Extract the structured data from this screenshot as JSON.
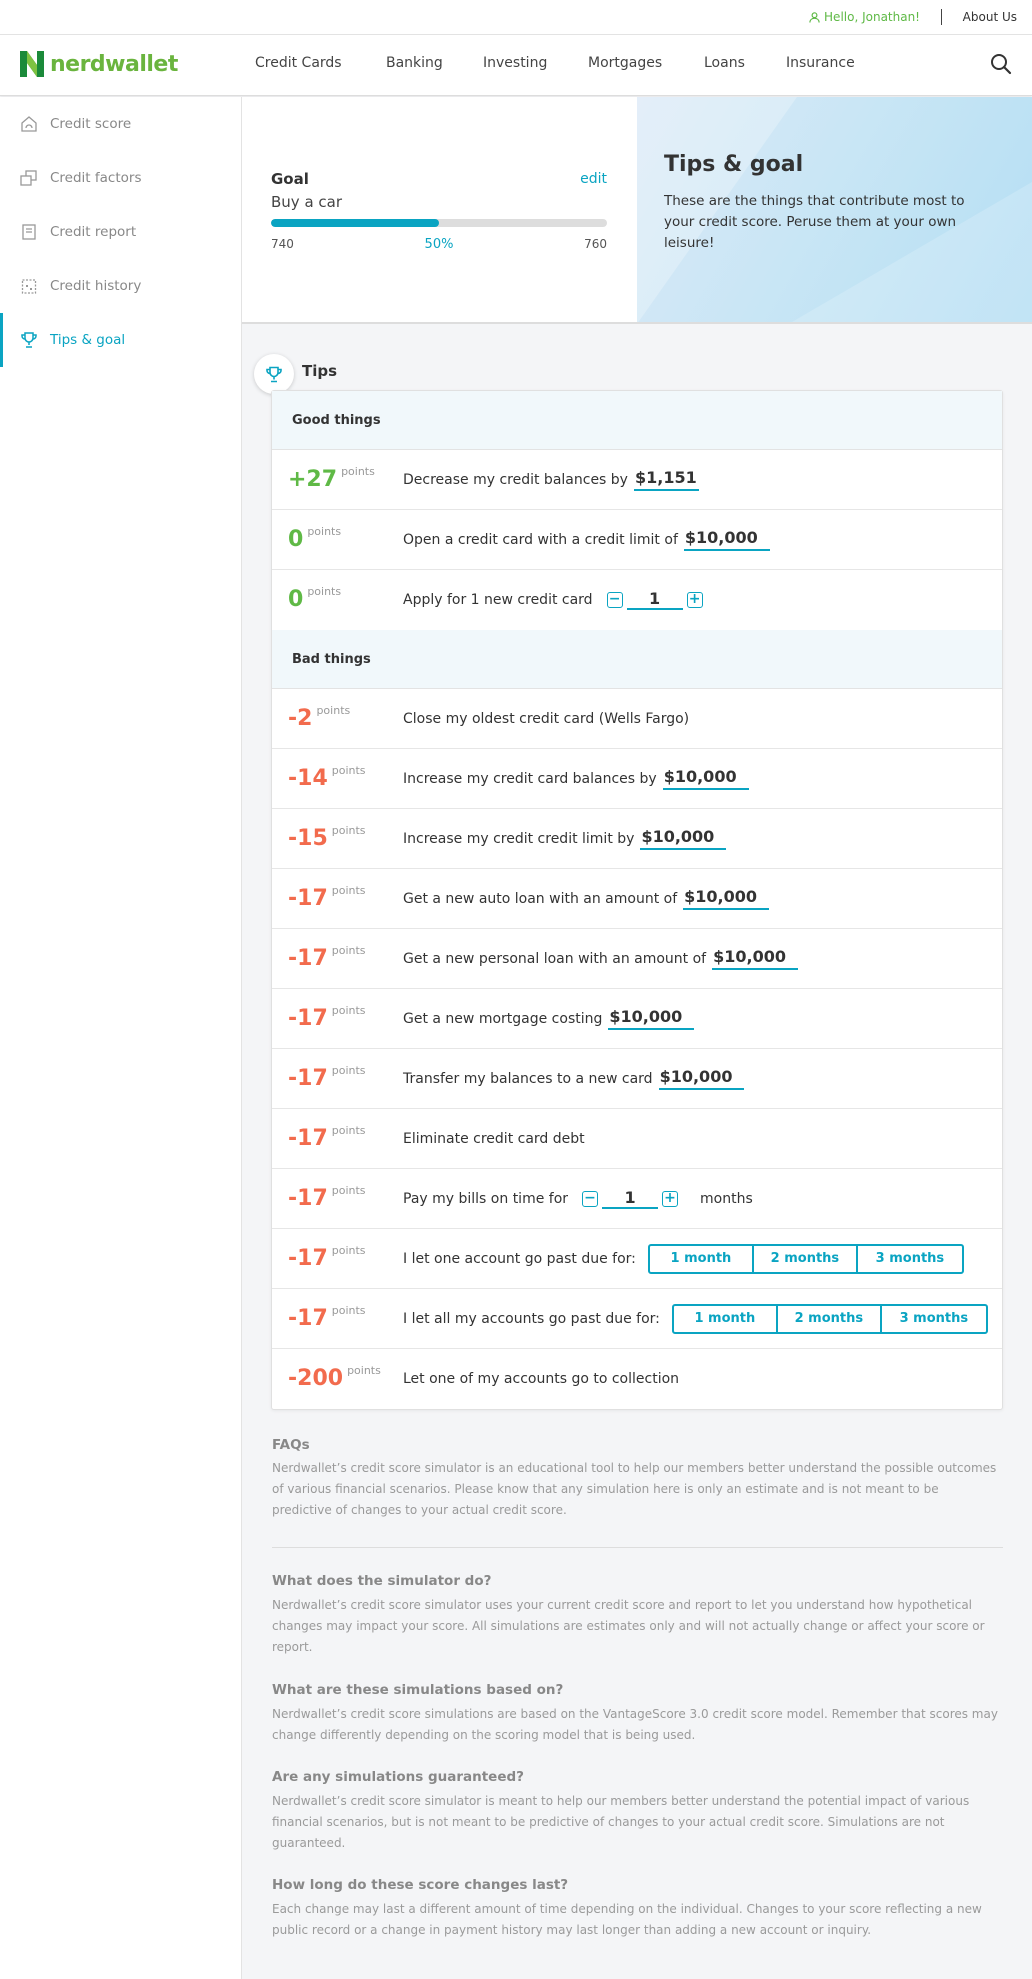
{
  "topbar": {
    "greeting": "Hello, Jonathan!",
    "about": "About Us"
  },
  "brand": {
    "name": "nerdwallet",
    "green": "#6ab43e",
    "accent": "#0aa4c2",
    "negative": "#f26b4d"
  },
  "nav": {
    "items": [
      "Credit Cards",
      "Banking",
      "Investing",
      "Mortgages",
      "Loans",
      "Insurance"
    ]
  },
  "sidebar": {
    "items": [
      {
        "label": "Credit score",
        "icon": "house-gauge-icon"
      },
      {
        "label": "Credit factors",
        "icon": "squares-icon"
      },
      {
        "label": "Credit report",
        "icon": "book-icon"
      },
      {
        "label": "Credit history",
        "icon": "calendar-icon"
      },
      {
        "label": "Tips & goal",
        "icon": "trophy-icon",
        "active": true
      }
    ]
  },
  "goal": {
    "label": "Goal",
    "edit": "edit",
    "name": "Buy a car",
    "min": "740",
    "max": "760",
    "percent_label": "50%",
    "progress": 0.5
  },
  "hero": {
    "title": "Tips & goal",
    "description": "These are the things that contribute most to your credit score. Peruse them at your own leisure!"
  },
  "tips": {
    "title": "Tips",
    "good_heading": "Good things",
    "bad_heading": "Bad things",
    "points_unit": "points",
    "good": [
      {
        "points": "+27",
        "text": "Decrease my credit balances by",
        "amount": "$1,151"
      },
      {
        "points": "0",
        "text": "Open a credit card with a credit limit of",
        "amount": "$10,000"
      },
      {
        "points": "0",
        "text": "Apply for 1 new credit card",
        "stepper": "1"
      }
    ],
    "bad": [
      {
        "points": "-2",
        "text": "Close my oldest credit card (Wells Fargo)"
      },
      {
        "points": "-14",
        "text": "Increase my credit card balances by",
        "amount": "$10,000"
      },
      {
        "points": "-15",
        "text": "Increase my credit credit limit by",
        "amount": "$10,000"
      },
      {
        "points": "-17",
        "text": "Get a new auto loan with an amount of",
        "amount": "$10,000"
      },
      {
        "points": "-17",
        "text": "Get a new personal loan with an amount of",
        "amount": "$10,000"
      },
      {
        "points": "-17",
        "text": "Get a new mortgage costing",
        "amount": "$10,000"
      },
      {
        "points": "-17",
        "text": "Transfer my balances to a new card",
        "amount": "$10,000"
      },
      {
        "points": "-17",
        "text": "Eliminate credit card debt"
      },
      {
        "points": "-17",
        "text": "Pay my bills on time for",
        "stepper": "1",
        "after": "months"
      },
      {
        "points": "-17",
        "text": "I let one account go past due for:",
        "options": [
          "1 month",
          "2 months",
          "3 months"
        ]
      },
      {
        "points": "-17",
        "text": "I let all my accounts go past due for:",
        "options": [
          "1 month",
          "2 months",
          "3 months"
        ]
      },
      {
        "points": "-200",
        "text": "Let one of my accounts go to collection"
      }
    ]
  },
  "faqs": {
    "title": "FAQs",
    "intro": "Nerdwallet’s credit score simulator is an educational tool to help our members better understand the possible outcomes of various financial scenarios. Please know that any simulation here is only an estimate and is not meant to be predictive of changes to your actual credit score.",
    "items": [
      {
        "q": "What does the simulator do?",
        "a": "Nerdwallet’s credit score simulator uses your current credit score and report to let you understand how hypothetical changes may impact your score. All simulations are estimates only and will not actually change or affect your score or report."
      },
      {
        "q": "What are these simulations based on?",
        "a": "Nerdwallet’s credit score simulations are based on the VantageScore 3.0 credit score model. Remember that scores may change differently depending on the scoring model that is being used."
      },
      {
        "q": "Are any simulations guaranteed?",
        "a": "Nerdwallet’s credit score simulator is meant to help our members better understand the potential impact of various financial scenarios, but is not meant to be predictive of changes to your actual credit score. Simulations are not guaranteed."
      },
      {
        "q": "How long do these score changes last?",
        "a": "Each change may last a different amount of time depending on the individual. Changes to your score reflecting a new public record or a change in payment history may last longer than adding a new account or inquiry."
      }
    ]
  }
}
